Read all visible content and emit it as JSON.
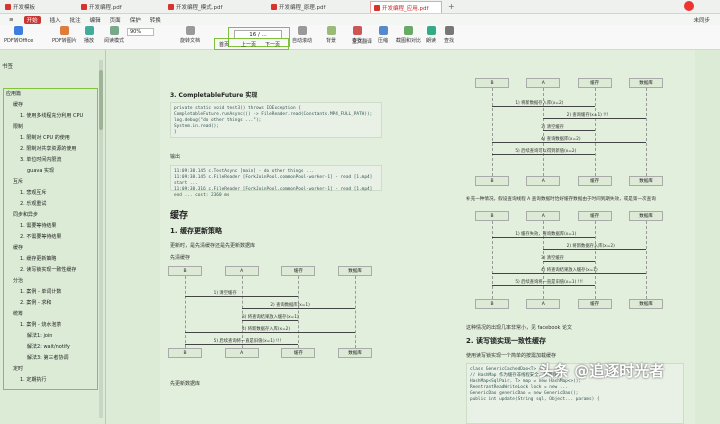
{
  "tabs": [
    {
      "label": "开发模板",
      "active": false
    },
    {
      "label": "开发编程.pdf",
      "active": false
    },
    {
      "label": "开发编程_模式.pdf",
      "active": false
    },
    {
      "label": "开发编程_原理.pdf",
      "active": false
    },
    {
      "label": "开发编程_应用.pdf",
      "active": true
    }
  ],
  "menu": {
    "items": [
      "开始",
      "插入",
      "批注",
      "编辑",
      "页面",
      "保护",
      "转换"
    ],
    "right": "未同步"
  },
  "toolbar": {
    "tools": [
      "PDF转Office",
      "PDF转图片",
      "播放",
      "阅读模式",
      "旋转文档",
      "单页",
      "双页",
      "连续阅读",
      "自动滚动",
      "背景",
      "查找",
      "全文翻译",
      "压缩",
      "截图和对比",
      "朗读",
      "查找"
    ],
    "zoom": "90%",
    "page": "16 / ...",
    "nav": [
      "首页",
      "上一页",
      "下一页"
    ]
  },
  "sidebar": {
    "title": "书签",
    "items": [
      "应用篇",
      "缓存",
      "1. 使用多线程充分利用 CPU",
      "限制",
      "1. 限制对 CPU 的使用",
      "2. 限制对共享资源的使用",
      "3. 单位时间内限流",
      "guava 实现",
      "互斥",
      "1. 悲观互斥",
      "2. 乐观重试",
      "同步和异步",
      "1. 需要等待结果",
      "2. 不需要等待结果",
      "缓存",
      "1. 缓存更新策略",
      "2. 读写锁实现一致性缓存",
      "分治",
      "1. 案例 - 单词计数",
      "2. 案例 - 求和",
      "统筹",
      "1. 案例 - 烧水泡茶",
      "解法1: join",
      "解法2: wait/notify",
      "解法3: 第三者协调",
      "定时",
      "1. 定期执行"
    ]
  },
  "page": {
    "h1": "3. CompletableFuture 实现",
    "code1": [
      "private static void test3() throws IOException {",
      "    CompletableFuture.runAsync(() -> FileReader.read(Constants.MP4_FULL_PATH));",
      "    log.debug(\"do other things ...\");",
      "    System.in.read();",
      "}"
    ],
    "out_label": "输出",
    "code2": [
      "11:09:38.145 c.TestAsync [main] - do other things ...",
      "11:09:38.145 c.FileReader [ForkJoinPool.commonPool-worker-1] - read [1.mp4] start ...",
      "11:09:38.316 c.FileReader [ForkJoinPool.commonPool-worker-1] - read [1.mp4] end ... cost: 2360 ms"
    ],
    "h_cache": "缓存",
    "h_update": "1. 缓存更新策略",
    "p_update": "更新时，是先清缓存还是先更新数据库",
    "p_clear": "先清缓存",
    "p_db": "先更新数据库",
    "p_mid": "补充一种情况，假设查询线程 A 查询数据时恰好缓存数据由于时间到期失效，或是第一次查询",
    "p_rare": "这种情况的出现几率非常小，见 facebook 论文",
    "h_rw": "2. 读写锁实现一致性缓存",
    "p_rw": "使用读写锁实现一个简单的按需加载缓存",
    "code3": [
      "class GenericCachedDao<T> {",
      "    // HashMap 作为缓存非线程安全, 需要保护",
      "    HashMap<SqlPair, T> map = new HashMap<>();",
      "",
      "    ReentrantReadWriteLock lock = new ...",
      "    GenericDao genericDao = new GenericDao();",
      "",
      "    public int update(String sql, Object... params) {"
    ],
    "seq_left": {
      "actors": [
        "B",
        "A",
        "缓存",
        "数据库"
      ],
      "msgs": [
        "1) 清空缓存",
        "2) 查询数据库(x=1)",
        "3) 将查询结果放入缓存(x=1)",
        "4) 将新数据存入库(x=2)",
        "5) 后续查询将一直是旧值(x=1) !!!"
      ]
    },
    "seq_r1": {
      "actors": [
        "B",
        "A",
        "缓存",
        "数据库"
      ],
      "msgs": [
        "1) 将新数据存入库(x=2)",
        "2) 查询缓存(x=1) !!!",
        "3) 清空缓存",
        "4) 查询数据库(x=2)",
        "5) 后续查询可以得到新值(x=2)"
      ]
    },
    "seq_r2": {
      "actors": [
        "B",
        "A",
        "缓存",
        "数据库"
      ],
      "msgs": [
        "1) 缓存失效，查询数据库(x=1)",
        "2) 将新数据存入库(x=2)",
        "3) 清空缓存",
        "4) 将查询结果放入缓存(x=1)",
        "5) 后续查询将一直是旧值(x=1) !!!"
      ]
    }
  },
  "watermark": "头条 @追逐时光者"
}
